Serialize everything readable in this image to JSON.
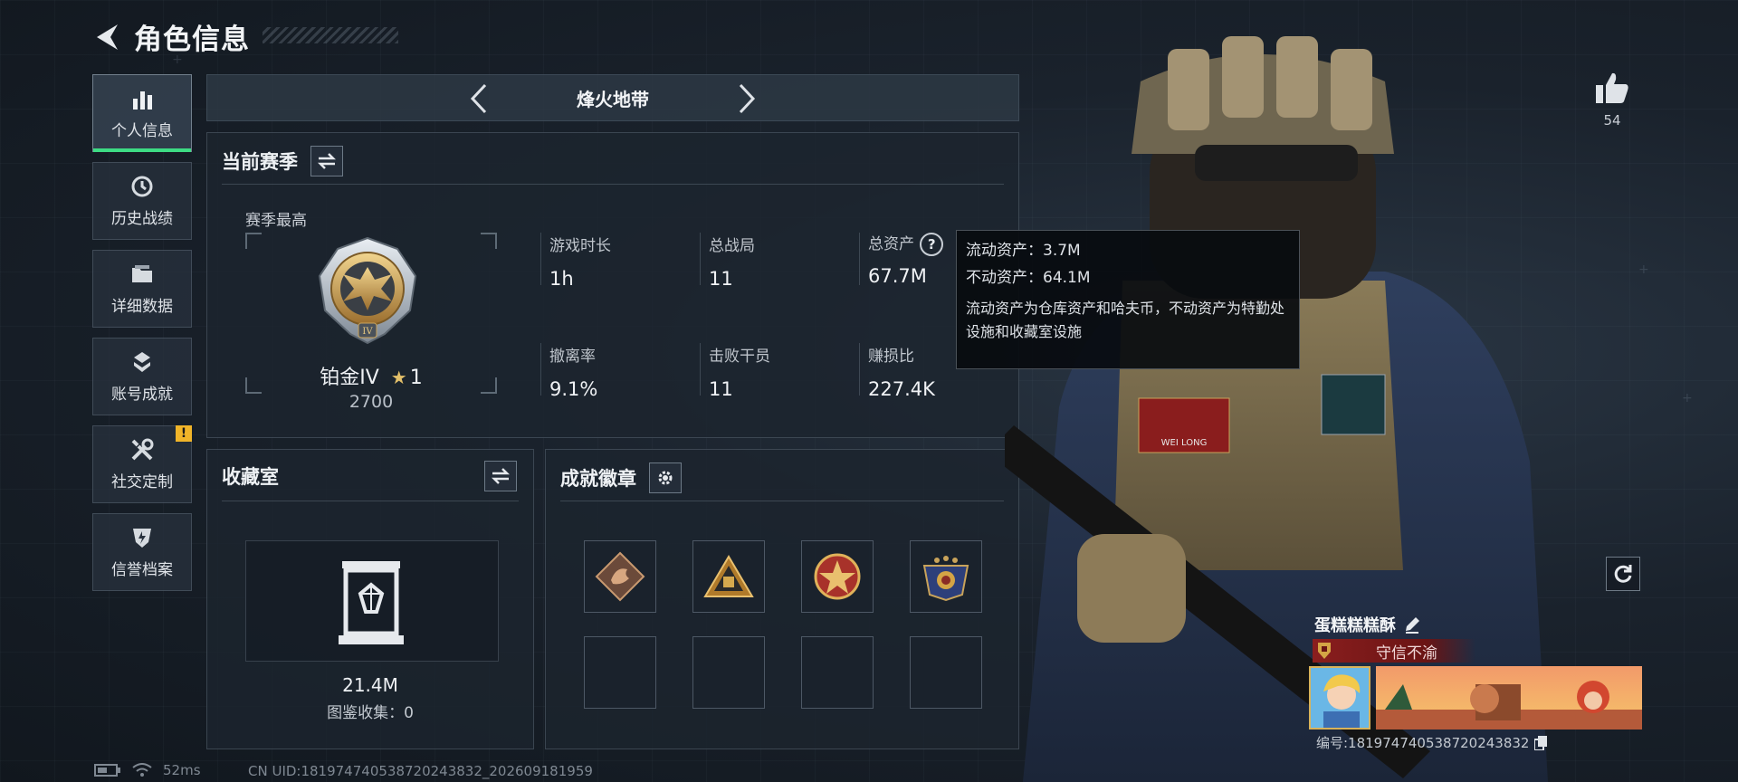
{
  "header": {
    "title": "角色信息"
  },
  "sidebar": {
    "items": [
      {
        "label": "个人信息",
        "icon": "bar-chart-icon",
        "active": true
      },
      {
        "label": "历史战绩",
        "icon": "history-clock-icon"
      },
      {
        "label": "详细数据",
        "icon": "folder-icon"
      },
      {
        "label": "账号成就",
        "icon": "achievement-icon"
      },
      {
        "label": "社交定制",
        "icon": "tools-icon",
        "alert": "!"
      },
      {
        "label": "信誉档案",
        "icon": "shield-icon"
      }
    ]
  },
  "modebar": {
    "title": "烽火地带"
  },
  "season": {
    "title": "当前赛季",
    "best_label": "赛季最高",
    "rank_name": "铂金IV",
    "rank_stars": "1",
    "rank_score": "2700",
    "stats": [
      {
        "label": "游戏时长",
        "value": "1h"
      },
      {
        "label": "总战局",
        "value": "11"
      },
      {
        "label": "总资产",
        "value": "67.7M"
      },
      {
        "label": "撤离率",
        "value": "9.1%"
      },
      {
        "label": "击败干员",
        "value": "11"
      },
      {
        "label": "赚损比",
        "value": "227.4K"
      }
    ],
    "help_glyph": "?"
  },
  "tooltip": {
    "liquid": "流动资产：3.7M",
    "fixed": "不动资产：64.1M",
    "note": "流动资产为仓库资产和哈夫币，不动资产为特勤处设施和收藏室设施"
  },
  "collection": {
    "title": "收藏室",
    "value": "21.4M",
    "sub": "图鉴收集：0"
  },
  "badges": {
    "title": "成就徽章",
    "slots": [
      "dragon-badge",
      "pyramid-badge",
      "star-medal-badge",
      "eagle-wing-badge",
      "",
      "",
      "",
      ""
    ]
  },
  "profile": {
    "likes": "54",
    "name": "蛋糕糕糕酥",
    "title_plate": "守信不渝",
    "id_line": "编号:18197474053872024383​2"
  },
  "status": {
    "ping": "52ms",
    "uid": "CN UID:18197474053872024383​2_202609181959"
  },
  "colors": {
    "accent": "#3ddc84",
    "alert": "#f0b429",
    "title_plate": "#8a1e1e"
  }
}
